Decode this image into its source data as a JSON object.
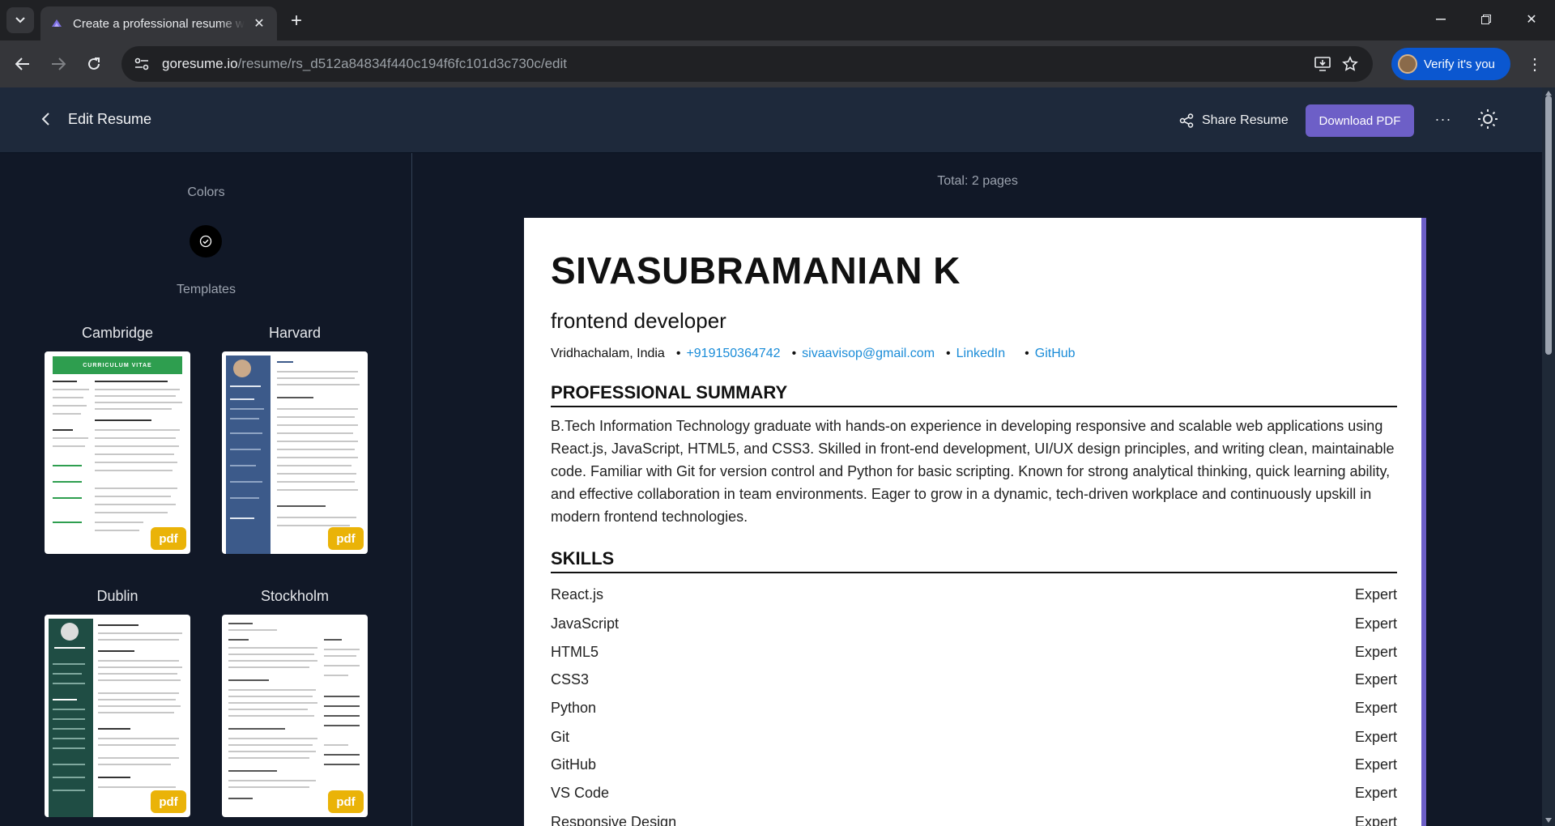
{
  "browser": {
    "tab_title": "Create a professional resume w",
    "url_host": "goresume.io",
    "url_path": "/resume/rs_d512a84834f440c194f6fc101d3c730c/edit",
    "verify_label": "Verify it's you"
  },
  "appbar": {
    "title": "Edit Resume",
    "share_label": "Share Resume",
    "download_label": "Download PDF"
  },
  "sidebar": {
    "colors_heading": "Colors",
    "templates_heading": "Templates",
    "templates": [
      {
        "name": "Cambridge",
        "badge": "pdf",
        "header_text": "CURRICULUM VITAE"
      },
      {
        "name": "Harvard",
        "badge": "pdf"
      },
      {
        "name": "Dublin",
        "badge": "pdf"
      },
      {
        "name": "Stockholm",
        "badge": "pdf"
      }
    ],
    "selected_color": "#000000"
  },
  "preview": {
    "total_pages": "Total: 2 pages",
    "accent": "#6d5fc7"
  },
  "resume": {
    "name": "SIVASUBRAMANIAN K",
    "role": "frontend developer",
    "location": "Vridhachalam, India",
    "phone": "+919150364742",
    "email": "sivaavisop@gmail.com",
    "linkedin": "LinkedIn",
    "github": "GitHub",
    "summary_heading": "PROFESSIONAL SUMMARY",
    "summary": "B.Tech Information Technology graduate with hands-on experience in developing responsive and scalable web applications using React.js, JavaScript, HTML5, and CSS3. Skilled in front-end development, UI/UX design principles, and writing clean, maintainable code. Familiar with Git for version control and Python for basic scripting. Known for strong analytical thinking, quick learning ability, and effective collaboration in team environments. Eager to grow in a dynamic, tech-driven workplace and continuously upskill in modern frontend technologies.",
    "skills_heading": "SKILLS",
    "skills": [
      {
        "name": "React.js",
        "level": "Expert"
      },
      {
        "name": "JavaScript",
        "level": "Expert"
      },
      {
        "name": "HTML5",
        "level": "Expert"
      },
      {
        "name": "CSS3",
        "level": "Expert"
      },
      {
        "name": "Python",
        "level": "Expert"
      },
      {
        "name": "Git",
        "level": "Expert"
      },
      {
        "name": "GitHub",
        "level": "Expert"
      },
      {
        "name": "VS Code",
        "level": "Expert"
      },
      {
        "name": "Responsive Design",
        "level": "Expert"
      }
    ]
  }
}
